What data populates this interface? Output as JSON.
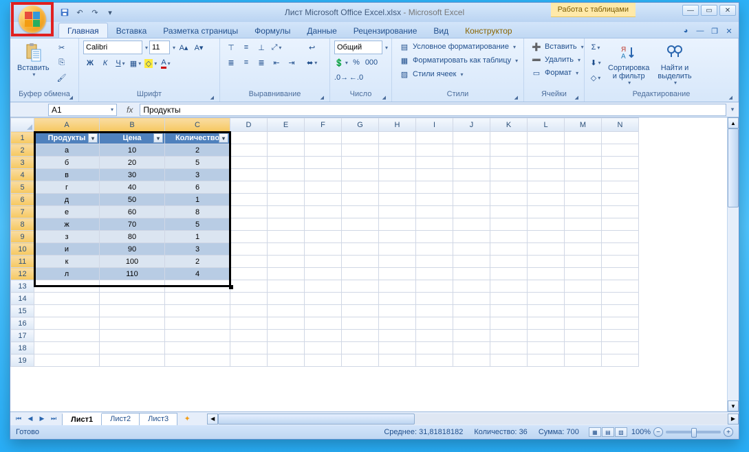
{
  "title": {
    "doc": "Лист Microsoft Office Excel.xlsx",
    "app": "Microsoft Excel",
    "sep": " - "
  },
  "context_tab_label": "Работа с таблицами",
  "tabs": [
    "Главная",
    "Вставка",
    "Разметка страницы",
    "Формулы",
    "Данные",
    "Рецензирование",
    "Вид",
    "Конструктор"
  ],
  "active_tab": 0,
  "ribbon": {
    "clipboard": {
      "label": "Буфер обмена",
      "paste": "Вставить"
    },
    "font": {
      "label": "Шрифт",
      "name": "Calibri",
      "size": "11"
    },
    "alignment": {
      "label": "Выравнивание"
    },
    "number": {
      "label": "Число",
      "format": "Общий"
    },
    "styles": {
      "label": "Стили",
      "cond": "Условное форматирование",
      "astable": "Форматировать как таблицу",
      "cellstyles": "Стили ячеек"
    },
    "cells": {
      "label": "Ячейки",
      "insert": "Вставить",
      "delete": "Удалить",
      "format": "Формат"
    },
    "editing": {
      "label": "Редактирование",
      "sort": "Сортировка\nи фильтр",
      "find": "Найти и\nвыделить"
    }
  },
  "namebox_value": "A1",
  "formula_value": "Продукты",
  "columns": [
    "A",
    "B",
    "C",
    "D",
    "E",
    "F",
    "G",
    "H",
    "I",
    "J",
    "K",
    "L",
    "M",
    "N"
  ],
  "col_widths": {
    "data": 95,
    "other": 54
  },
  "row_count": 19,
  "table": {
    "headers": [
      "Продукты",
      "Цена",
      "Количество"
    ],
    "rows": [
      [
        "а",
        "10",
        "2"
      ],
      [
        "б",
        "20",
        "5"
      ],
      [
        "в",
        "30",
        "3"
      ],
      [
        "г",
        "40",
        "6"
      ],
      [
        "д",
        "50",
        "1"
      ],
      [
        "е",
        "60",
        "8"
      ],
      [
        "ж",
        "70",
        "5"
      ],
      [
        "з",
        "80",
        "1"
      ],
      [
        "и",
        "90",
        "3"
      ],
      [
        "к",
        "100",
        "2"
      ],
      [
        "л",
        "110",
        "4"
      ]
    ],
    "selected_range": "A1:C12"
  },
  "sheet_tabs": [
    "Лист1",
    "Лист2",
    "Лист3"
  ],
  "active_sheet": 0,
  "status": {
    "ready": "Готово",
    "avg_label": "Среднее:",
    "avg": "31,81818182",
    "count_label": "Количество:",
    "count": "36",
    "sum_label": "Сумма:",
    "sum": "700",
    "zoom": "100%"
  }
}
